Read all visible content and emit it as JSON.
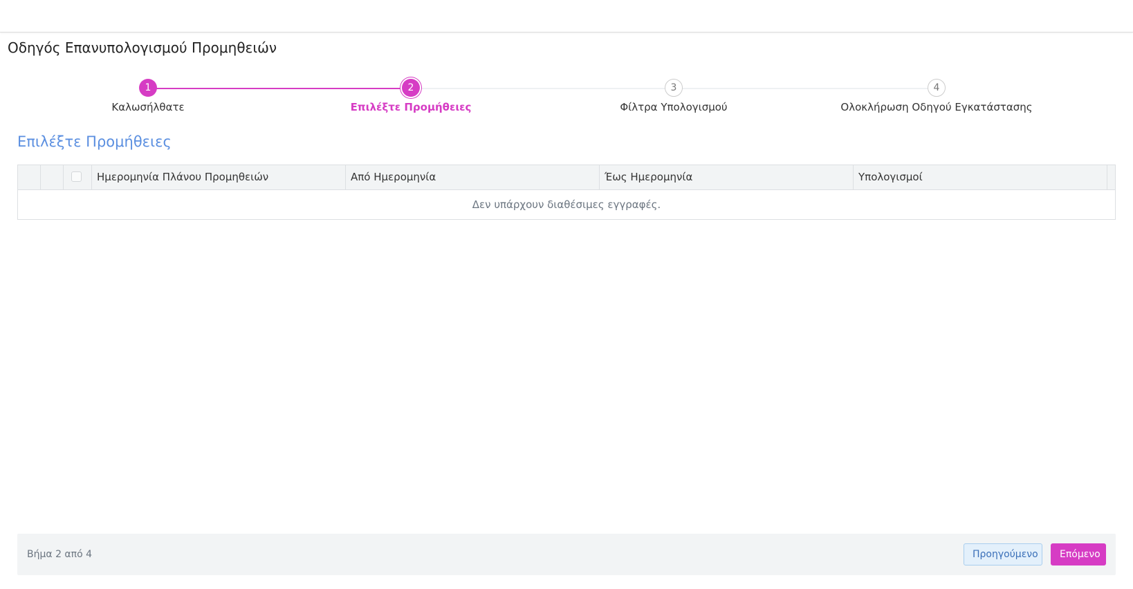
{
  "wizard": {
    "title": "Οδηγός Επανυπολογισμού Προμηθειών"
  },
  "stepper": {
    "steps": [
      {
        "number": "1",
        "label": "Καλωσήλθατε",
        "state": "done"
      },
      {
        "number": "2",
        "label": "Επιλέξτε Προμήθειες",
        "state": "active"
      },
      {
        "number": "3",
        "label": "Φίλτρα Υπολογισμού",
        "state": "todo"
      },
      {
        "number": "4",
        "label": "Ολοκλήρωση Οδηγού Εγκατάστασης",
        "state": "todo"
      }
    ],
    "accent_color": "#d63cc4"
  },
  "section": {
    "heading": "Επιλέξτε Προμήθειες",
    "heading_color": "#5b8fe0"
  },
  "grid": {
    "columns": [
      "Ημερομηνία Πλάνου Προμηθειών",
      "Από Ημερομηνία",
      "Έως Ημερομηνία",
      "Υπολογισμοί"
    ],
    "empty_message": "Δεν υπάρχουν διαθέσιμες εγγραφές."
  },
  "footer": {
    "step_counter": "Βήμα 2 από 4",
    "prev_label": "Προηγούμενο",
    "next_label": "Επόμενο"
  }
}
